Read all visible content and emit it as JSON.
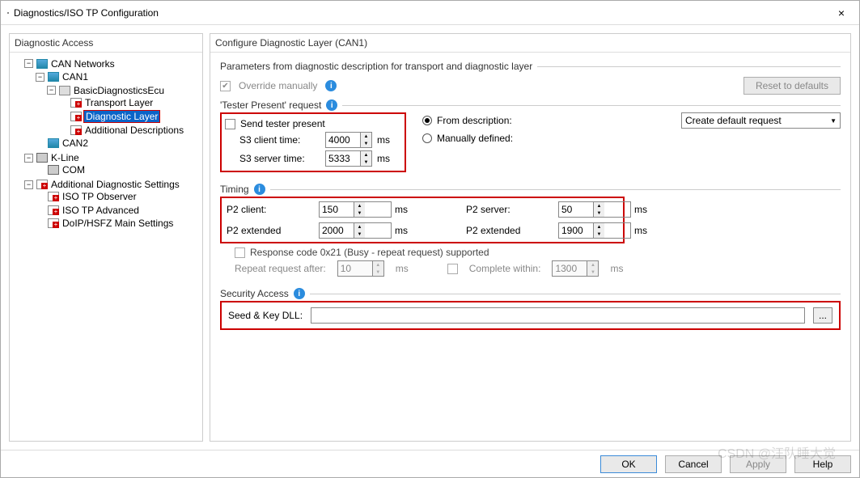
{
  "window": {
    "title": "Diagnostics/ISO TP Configuration",
    "close": "×"
  },
  "leftPanel": {
    "title": "Diagnostic Access"
  },
  "tree": {
    "canNetworks": "CAN Networks",
    "can1": "CAN1",
    "ecu": "BasicDiagnosticsEcu",
    "transport": "Transport Layer",
    "diagLayer": "Diagnostic Layer",
    "addlDesc": "Additional Descriptions",
    "can2": "CAN2",
    "kline": "K-Line",
    "com": "COM",
    "addlSettings": "Additional Diagnostic Settings",
    "isoObs": "ISO TP Observer",
    "isoAdv": "ISO TP Advanced",
    "doip": "DoIP/HSFZ Main Settings"
  },
  "rightPanel": {
    "title": "Configure Diagnostic Layer (CAN1)",
    "paramsHeader": "Parameters from diagnostic description for transport and diagnostic layer",
    "overrideManually": "Override manually",
    "resetBtn": "Reset to defaults"
  },
  "tester": {
    "header": "'Tester Present' request",
    "sendTester": "Send tester present",
    "s3client": "S3 client time:",
    "s3client_val": "4000",
    "s3server": "S3 server time:",
    "s3server_val": "5333",
    "unit": "ms",
    "fromDesc": "From description:",
    "manual": "Manually defined:",
    "selectVal": "Create default request"
  },
  "timing": {
    "header": "Timing",
    "p2client": "P2 client:",
    "p2client_val": "150",
    "p2server": "P2 server:",
    "p2server_val": "50",
    "p2extc": "P2 extended",
    "p2extc_val": "2000",
    "p2exts": "P2 extended",
    "p2exts_val": "1900",
    "unit": "ms",
    "resp21": "Response code 0x21 (Busy - repeat request) supported",
    "repeatAfter": "Repeat request after:",
    "repeat_val": "10",
    "completeWithin": "Complete within:",
    "complete_val": "1300"
  },
  "security": {
    "header": "Security Access",
    "seedKey": "Seed & Key DLL:",
    "browse": "..."
  },
  "footer": {
    "ok": "OK",
    "cancel": "Cancel",
    "apply": "Apply",
    "help": "Help"
  },
  "watermark": "CSDN @汪队睡大觉"
}
